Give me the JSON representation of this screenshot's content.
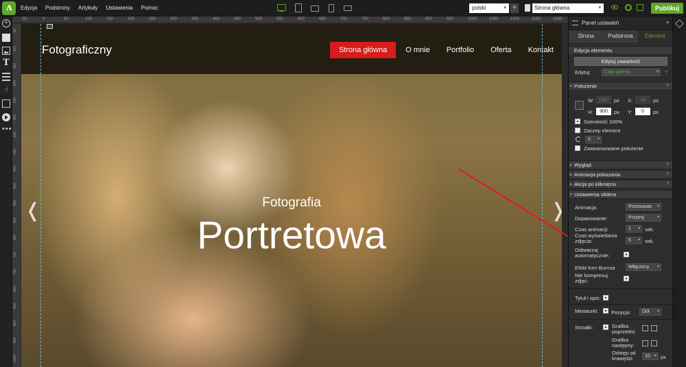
{
  "menu": [
    "Edycja",
    "Podstrony",
    "Artykuły",
    "Ustawienia",
    "Pomoc"
  ],
  "toolbar": {
    "language": "polski",
    "lang_add": "+",
    "page": "Strona główna",
    "publish": "Publikuj"
  },
  "ruler_top": [
    "-50",
    "0",
    "50",
    "100",
    "150",
    "200",
    "250",
    "300",
    "350",
    "400",
    "450",
    "500",
    "550",
    "600",
    "650",
    "700",
    "750",
    "800",
    "850",
    "900",
    "950",
    "1000",
    "1050",
    "1100",
    "1150",
    "1200"
  ],
  "ruler_left": [
    "50",
    "100",
    "150",
    "200",
    "250",
    "300",
    "350",
    "400",
    "450",
    "500",
    "550",
    "600",
    "650",
    "700",
    "750",
    "800",
    "850",
    "900",
    "950",
    "1000"
  ],
  "site": {
    "logo": "Fotograficzny",
    "nav": [
      "Strona główna",
      "O mnie",
      "Portfolio",
      "Oferta",
      "Kontakt"
    ],
    "slide_subtitle": "Fotografia",
    "slide_title": "Portretowa",
    "arrow_prev": "❬",
    "arrow_next": "❭"
  },
  "panel": {
    "title": "Panel ustawień",
    "tabs": [
      "Strona",
      "Podstrona",
      "Element"
    ],
    "edit_element": "Edycja elementu",
    "edit_content_button": "Edytuj zawartość",
    "edit_label": "Edytuj:",
    "edit_value": "Cała galeria",
    "position_section": "Położenie",
    "w_label": "W:",
    "w_value": "1287",
    "px1": "px",
    "x_label": "X:",
    "x_value": "-43",
    "px2": "px",
    "h_label": "H:",
    "h_value": "900",
    "px3": "px",
    "y_label": "Y:",
    "y_value": "0",
    "px4": "px",
    "width100": "Szerokość 100%",
    "anchor": "Zaczep element",
    "rotate_value": "0",
    "advanced_position": "Zaawansowane położenie",
    "appearance": "Wygląd",
    "show_animation": "Animacja pokazania",
    "click_action": "Akcja po kliknięciu",
    "slider_settings": "Ustawienia slidera",
    "animation_label": "Animacja:",
    "animation_value": "Przesuwan",
    "fit_label": "Dopasowanie:",
    "fit_value": "Przytnij",
    "anim_time_label": "Czas animacji:",
    "anim_time_value": "1",
    "sec1": "sek.",
    "display_time_label": "Czas wyświetlania zdjęcia:",
    "display_time_value": "5",
    "sec2": "sek.",
    "autoplay_label": "Odtwarzaj automatycznie:",
    "ken_burns_label": "Efekt Ken Burnsa",
    "ken_burns_value": "Włączony",
    "no_compress_label": "Nie kompresuj zdjęć:",
    "title_desc_label": "Tytuł i opis:",
    "thumbs_label": "Miniaturki:",
    "position_label": "Pozycja:",
    "position_value": "Dół",
    "arrows_label": "Strzałki:",
    "prev_graphic_label": "Grafika poprzedni:",
    "next_graphic_label": "Grafika następny:",
    "edge_distance_label": "Odstęp od krawędzi:",
    "edge_distance_value": "10",
    "px5": "px",
    "q": "?"
  }
}
